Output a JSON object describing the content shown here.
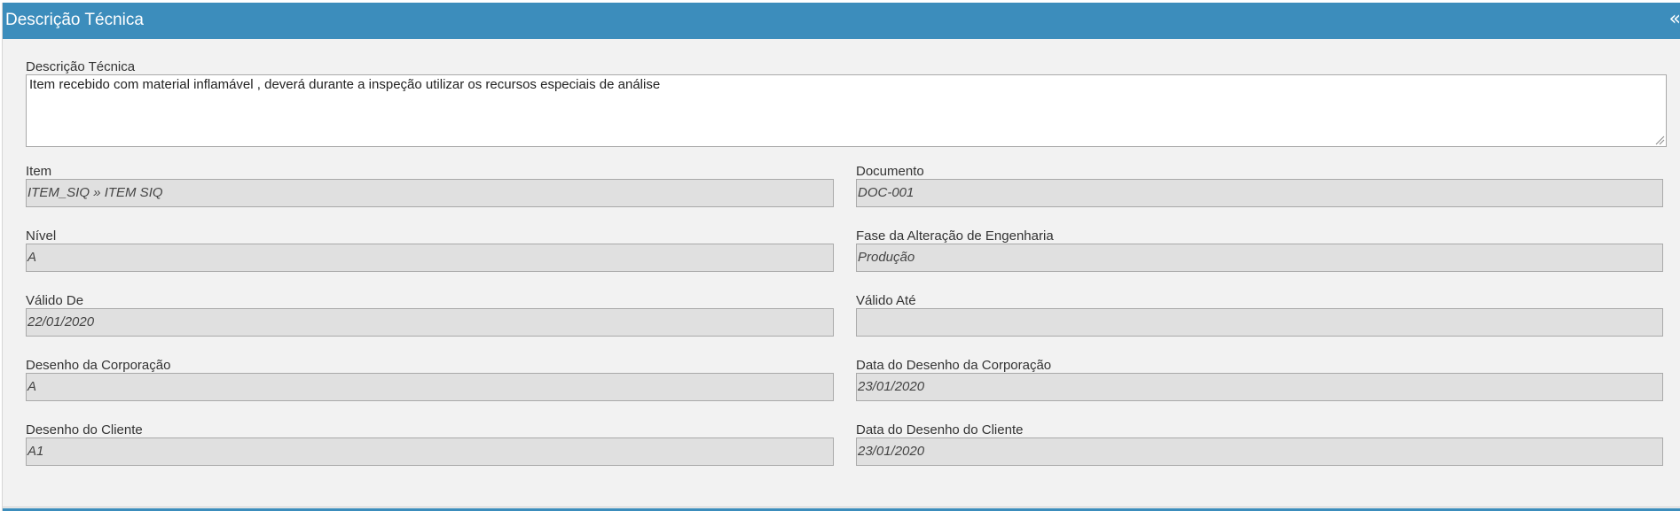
{
  "panel": {
    "title": "Descrição Técnica",
    "collapse_glyph": "«",
    "collapse_icon": "double-chevron-left-icon"
  },
  "description": {
    "label": "Descrição Técnica",
    "value": "Item recebido com material inflamável , deverá durante a inspeção utilizar os recursos especiais de análise"
  },
  "fields": {
    "item": {
      "label": "Item",
      "value": "ITEM_SIQ » ITEM SIQ"
    },
    "documento": {
      "label": "Documento",
      "value": "DOC-001"
    },
    "nivel": {
      "label": "Nível",
      "value": "A"
    },
    "fase": {
      "label": "Fase da Alteração de Engenharia",
      "value": "Produção"
    },
    "valido_de": {
      "label": "Válido De",
      "value": "22/01/2020"
    },
    "valido_ate": {
      "label": "Válido Até",
      "value": ""
    },
    "desenho_corporacao": {
      "label": "Desenho da Corporação",
      "value": "A"
    },
    "data_desenho_corporacao": {
      "label": "Data do Desenho da Corporação",
      "value": "23/01/2020"
    },
    "desenho_cliente": {
      "label": "Desenho do Cliente",
      "value": "A1"
    },
    "data_desenho_cliente": {
      "label": "Data do Desenho do Cliente",
      "value": "23/01/2020"
    }
  },
  "colors": {
    "header_bg": "#3c8dbc",
    "panel_bg": "#f2f2f2",
    "readonly_bg": "#e0e0e0"
  }
}
